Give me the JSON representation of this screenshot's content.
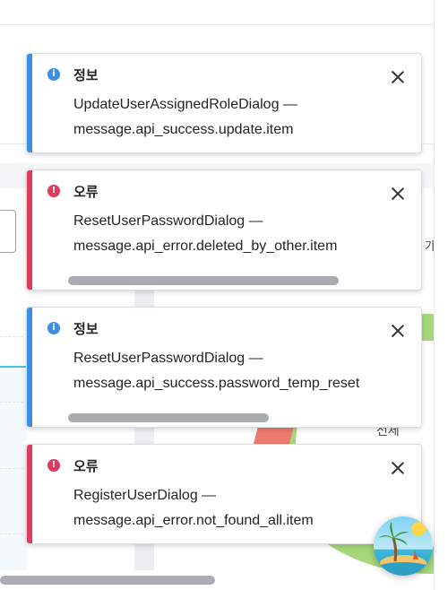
{
  "background": {
    "right_text": "가",
    "total_label": "전체"
  },
  "toasts": [
    {
      "type": "info",
      "icon": "info-icon",
      "title": "정보",
      "line1": "UpdateUserAssignedRoleDialog —",
      "line2": "message.api_success.update.item"
    },
    {
      "type": "error",
      "icon": "error-icon",
      "title": "오류",
      "line1": "ResetUserPasswordDialog —",
      "line2": "message.api_error.deleted_by_other.item"
    },
    {
      "type": "info",
      "icon": "info-icon",
      "title": "정보",
      "line1": "ResetUserPasswordDialog —",
      "line2": "message.api_success.password_temp_reset"
    },
    {
      "type": "error",
      "icon": "error-icon",
      "title": "오류",
      "line1": "RegisterUserDialog —",
      "line2": "message.api_error.not_found_all.item"
    }
  ],
  "colors": {
    "info": "#3b8fe5",
    "error": "#df3b5d",
    "chart_green": "#a7d77b",
    "chart_red": "#ec7a6f"
  },
  "fab": {
    "icon": "palm-island-icon"
  }
}
